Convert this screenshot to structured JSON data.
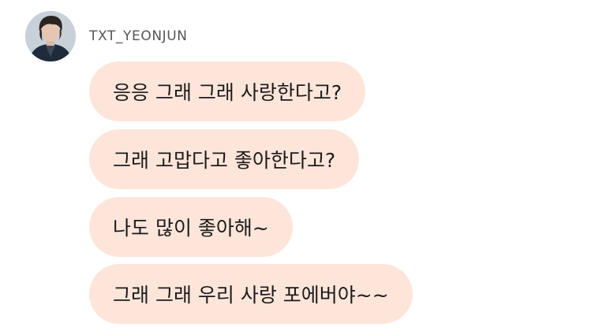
{
  "chat": {
    "sender_name": "TXT_YEONJUN",
    "avatar_icon": "profile-photo-avatar",
    "bubble_color": "#fee5da",
    "messages": [
      {
        "text": "응응 그래 그래 사랑한다고?"
      },
      {
        "text": "그래 고맙다고 좋아한다고?"
      },
      {
        "text": "나도 많이 좋아해~"
      },
      {
        "text": "그래 그래 우리 사랑 포에버야~~"
      }
    ]
  }
}
